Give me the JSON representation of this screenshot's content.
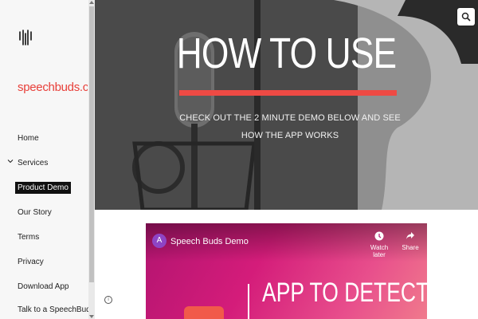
{
  "sidebar": {
    "brand": "speechbuds.c...",
    "items": [
      {
        "label": "Home"
      },
      {
        "label": "Services"
      },
      {
        "label": "Product Demo"
      },
      {
        "label": "Our Story"
      },
      {
        "label": "Terms"
      },
      {
        "label": "Privacy"
      },
      {
        "label": "Download App"
      },
      {
        "label": "Talk to a SpeechBuds"
      }
    ],
    "active_item": "Product Demo"
  },
  "hero": {
    "title": "HOW TO USE",
    "subtitle": "CHECK OUT THE 2 MINUTE DEMO BELOW AND SEE HOW THE APP WORKS"
  },
  "video": {
    "channel_initial": "A",
    "title": "Speech Buds Demo",
    "watch_later_label": "Watch later",
    "share_label": "Share",
    "headline": "APP TO DETECT AND"
  },
  "icons": {
    "logo": "sound-wave-icon",
    "search": "search-icon",
    "info": "info-icon",
    "services_expand": "chevron-down-icon"
  },
  "colors": {
    "brand_red": "#e8403a",
    "accent_bar": "#ee4a44",
    "video_magenta": "#d41c7a"
  }
}
